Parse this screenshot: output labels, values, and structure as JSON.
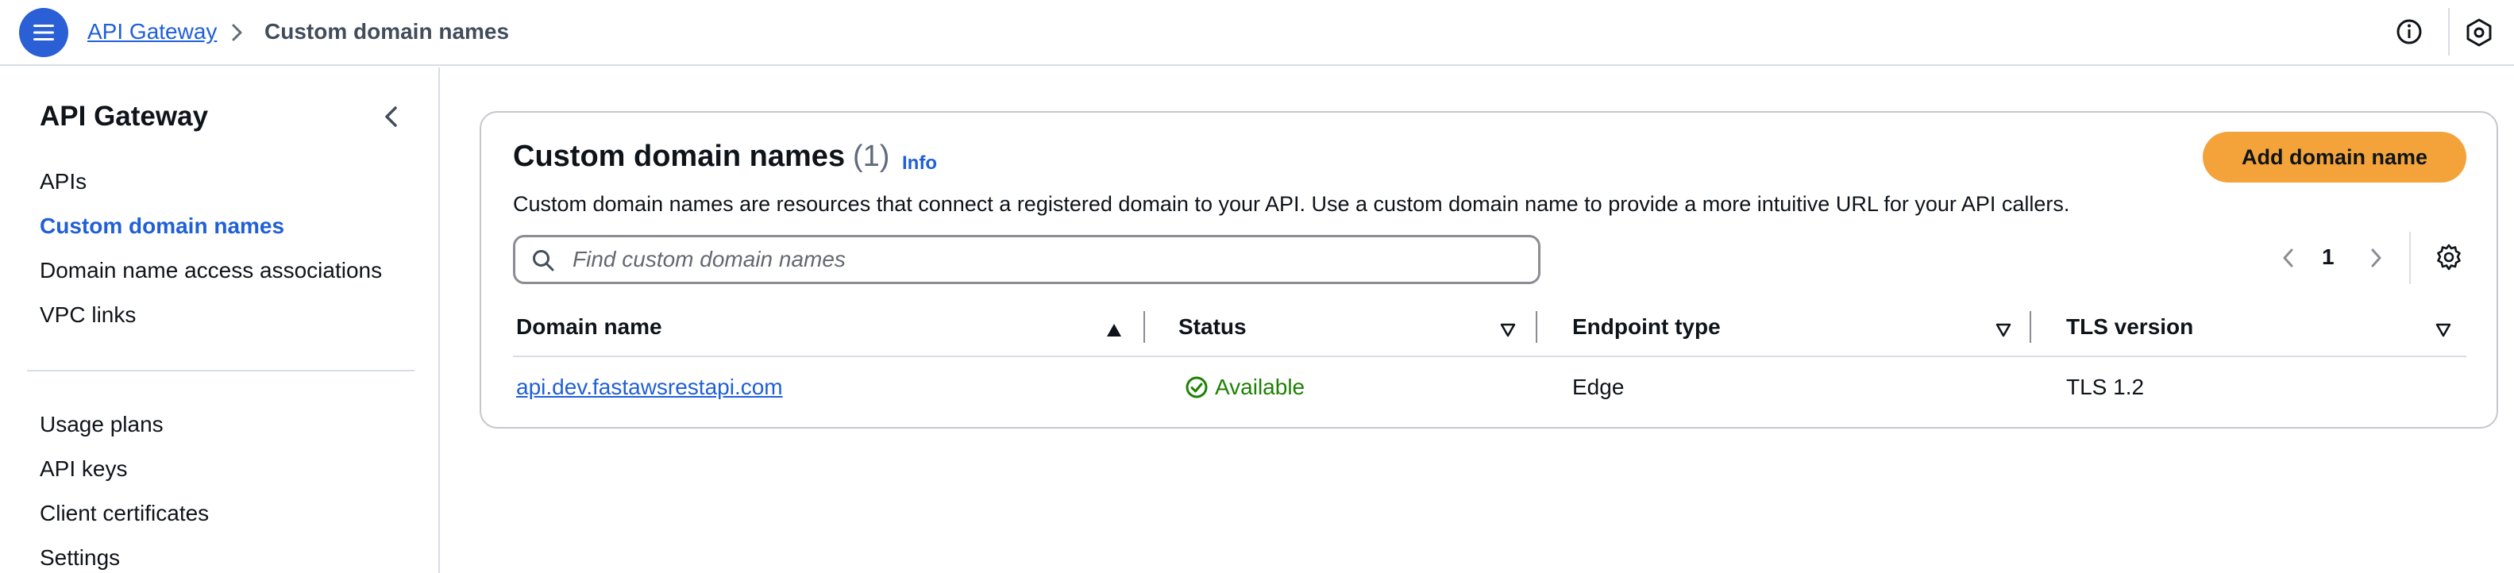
{
  "header": {
    "breadcrumb_root": "API Gateway",
    "breadcrumb_current": "Custom domain names"
  },
  "sidebar": {
    "title": "API Gateway",
    "items": [
      {
        "label": "APIs",
        "active": false
      },
      {
        "label": "Custom domain names",
        "active": true
      },
      {
        "label": "Domain name access associations",
        "active": false
      },
      {
        "label": "VPC links",
        "active": false
      }
    ],
    "items2": [
      {
        "label": "Usage plans"
      },
      {
        "label": "API keys"
      },
      {
        "label": "Client certificates"
      },
      {
        "label": "Settings"
      }
    ]
  },
  "main": {
    "title": "Custom domain names",
    "count": "(1)",
    "info_link": "Info",
    "description": "Custom domain names are resources that connect a registered domain to your API. Use a custom domain name to provide a more intuitive URL for your API callers.",
    "add_button": "Add domain name",
    "search": {
      "placeholder": "Find custom domain names",
      "value": ""
    },
    "pagination": {
      "current_page": "1"
    },
    "table": {
      "columns": [
        "Domain name",
        "Status",
        "Endpoint type",
        "TLS version"
      ],
      "rows": [
        {
          "domain": "api.dev.fastawsrestapi.com",
          "status": "Available",
          "endpoint_type": "Edge",
          "tls_version": "TLS 1.2"
        }
      ]
    }
  },
  "colors": {
    "accent": "#1f5fd8",
    "primary_button": "#f3a33a",
    "status_success": "#1d8102",
    "menu_button": "#2a5fd6"
  },
  "icons": [
    "menu-icon",
    "chevron-right-icon",
    "info-icon",
    "hexagon-icon",
    "chevron-left-icon",
    "search-icon",
    "gear-icon",
    "sort-ascending-icon",
    "sort-descending-icon",
    "check-circle-icon"
  ]
}
